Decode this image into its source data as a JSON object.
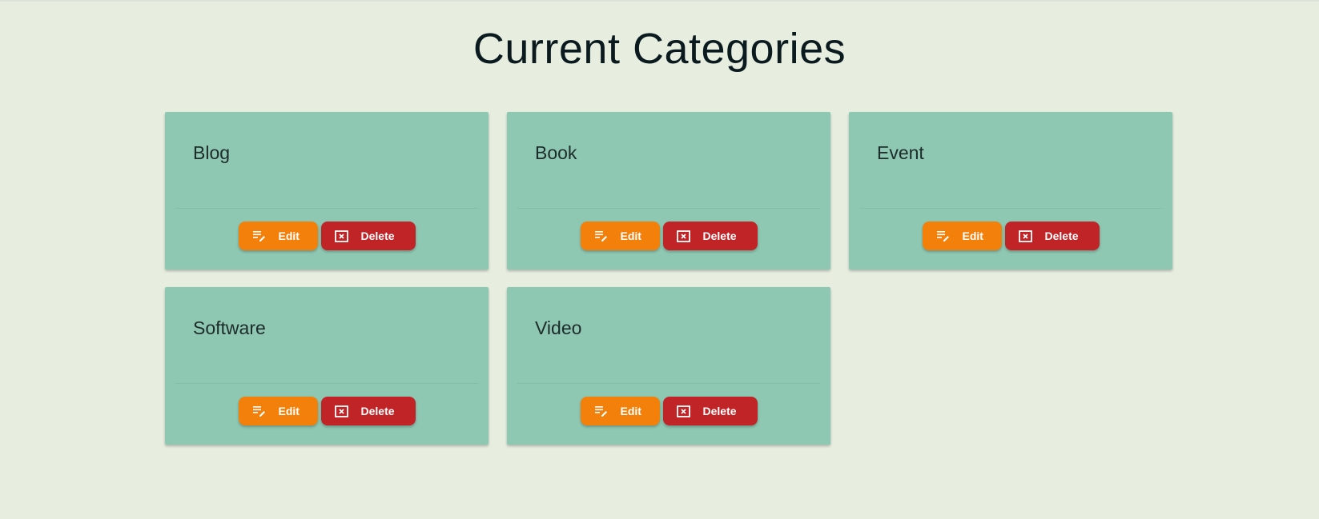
{
  "page": {
    "title": "Current Categories"
  },
  "buttons": {
    "edit": "Edit",
    "delete": "Delete"
  },
  "categories": [
    {
      "name": "Blog"
    },
    {
      "name": "Book"
    },
    {
      "name": "Event"
    },
    {
      "name": "Software"
    },
    {
      "name": "Video"
    }
  ],
  "colors": {
    "background": "#e7eee0",
    "card": "#8fc8b2",
    "edit": "#f4800c",
    "delete": "#c02427"
  },
  "icons": {
    "edit": "edit-note-icon",
    "delete": "close-box-icon"
  }
}
